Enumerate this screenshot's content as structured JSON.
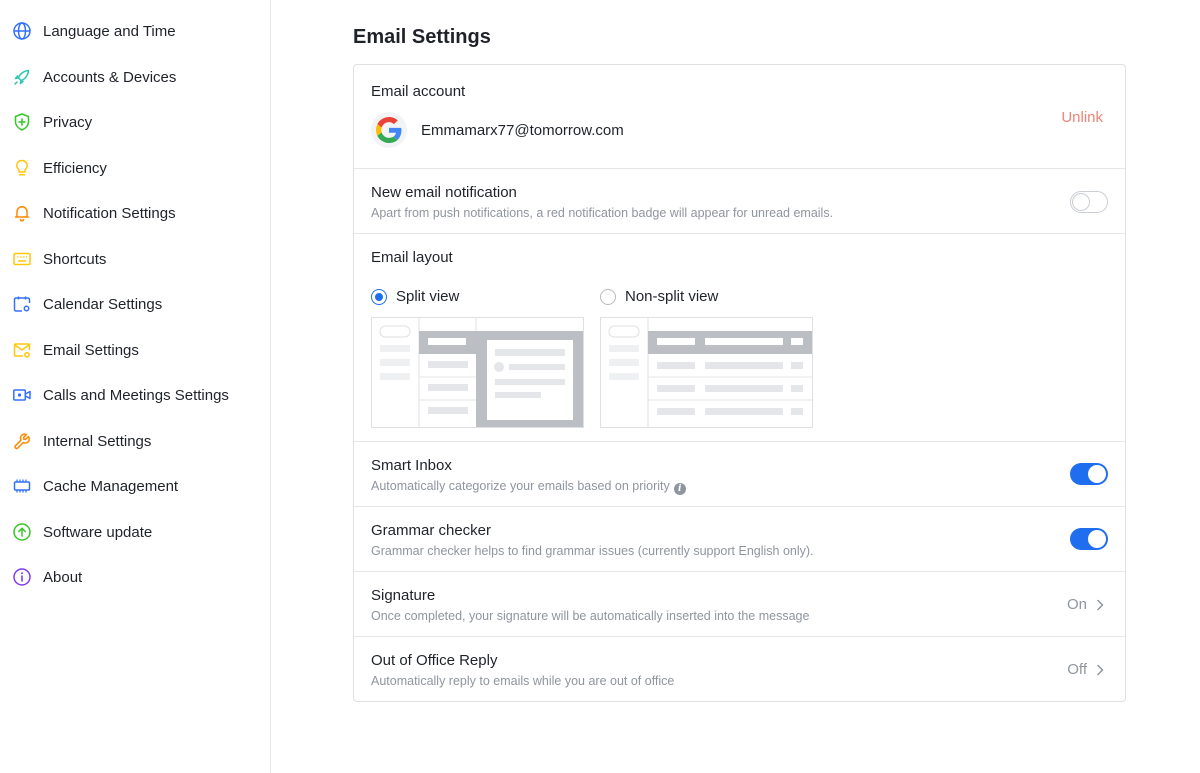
{
  "sidebar": {
    "items": [
      {
        "label": "Language and Time",
        "icon": "globe-icon"
      },
      {
        "label": "Accounts & Devices",
        "icon": "rocket-icon"
      },
      {
        "label": "Privacy",
        "icon": "shield-icon"
      },
      {
        "label": "Efficiency",
        "icon": "lightbulb-icon"
      },
      {
        "label": "Notification Settings",
        "icon": "bell-icon"
      },
      {
        "label": "Shortcuts",
        "icon": "keyboard-icon"
      },
      {
        "label": "Calendar Settings",
        "icon": "calendar-settings-icon"
      },
      {
        "label": "Email Settings",
        "icon": "mail-settings-icon"
      },
      {
        "label": "Calls and Meetings Settings",
        "icon": "video-camera-icon"
      },
      {
        "label": "Internal Settings",
        "icon": "wrench-icon"
      },
      {
        "label": "Cache Management",
        "icon": "memory-chip-icon"
      },
      {
        "label": "Software update",
        "icon": "upload-arrow-icon"
      },
      {
        "label": "About",
        "icon": "info-icon"
      }
    ]
  },
  "main": {
    "title": "Email Settings",
    "email_account": {
      "title": "Email account",
      "provider_icon": "google-icon",
      "address": "Emmamarx77@tomorrow.com",
      "unlink_label": "Unlink"
    },
    "new_email_notification": {
      "title": "New email notification",
      "description": "Apart from push notifications, a red notification badge will appear for unread emails.",
      "enabled": false
    },
    "email_layout": {
      "title": "Email layout",
      "options": [
        {
          "label": "Split view",
          "selected": true
        },
        {
          "label": "Non-split view",
          "selected": false
        }
      ]
    },
    "smart_inbox": {
      "title": "Smart Inbox",
      "description": "Automatically categorize your emails based on priority",
      "enabled": true
    },
    "grammar_checker": {
      "title": "Grammar checker",
      "description": "Grammar checker helps to find grammar issues (currently support English only).",
      "enabled": true
    },
    "signature": {
      "title": "Signature",
      "description": "Once completed, your signature will be automatically inserted into the message",
      "status": "On"
    },
    "out_of_office": {
      "title": "Out of Office Reply",
      "description": "Automatically reply to emails while you are out of office",
      "status": "Off"
    }
  },
  "colors": {
    "accent": "#1f6ef0",
    "unlink": "#f08377",
    "muted_text": "#8f959e",
    "border": "#dee0e3"
  }
}
